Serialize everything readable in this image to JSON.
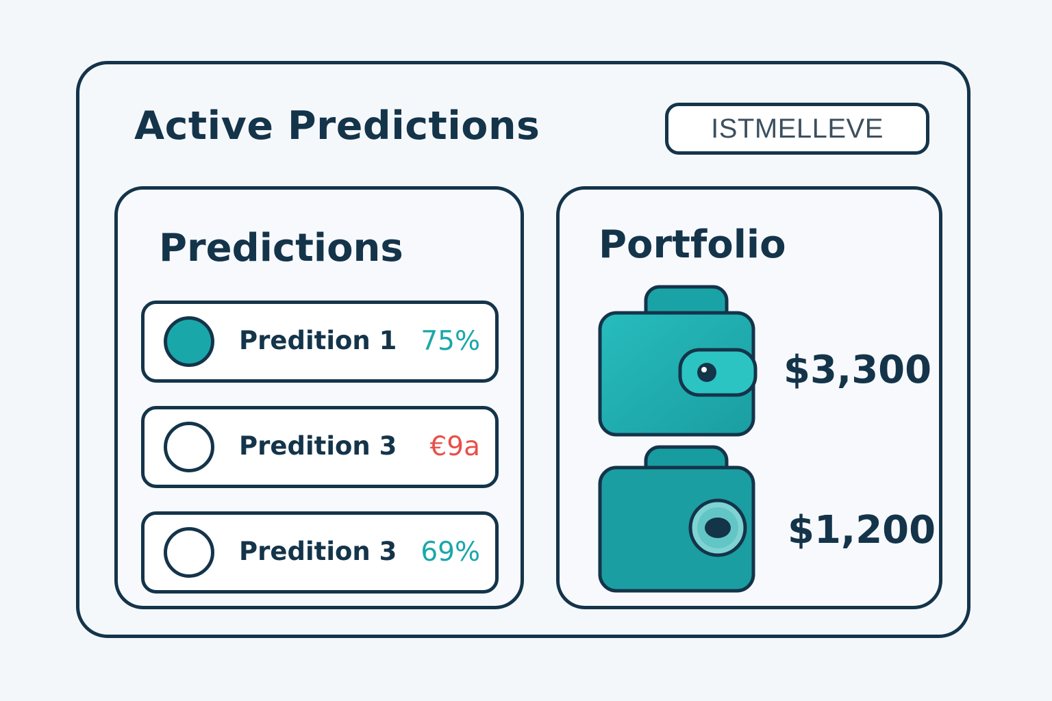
{
  "page": {
    "title": "Active Predictions",
    "header_button": "ISTMELLEVE"
  },
  "colors": {
    "ink": "#14344a",
    "teal": "#1aa7aa",
    "negative": "#e8504a",
    "background": "#f4f7fa"
  },
  "predictions": {
    "title": "Predictions",
    "items": [
      {
        "label": "Predition 1",
        "value": "75%",
        "status": "positive",
        "selected": true
      },
      {
        "label": "Predition 3",
        "value": "€9a",
        "status": "negative",
        "selected": false
      },
      {
        "label": "Predition 3",
        "value": "69%",
        "status": "positive",
        "selected": false
      }
    ]
  },
  "portfolio": {
    "title": "Portfolio",
    "items": [
      {
        "icon": "wallet-icon",
        "amount": "$3,300"
      },
      {
        "icon": "wallet-icon",
        "amount": "$1,200"
      }
    ]
  }
}
